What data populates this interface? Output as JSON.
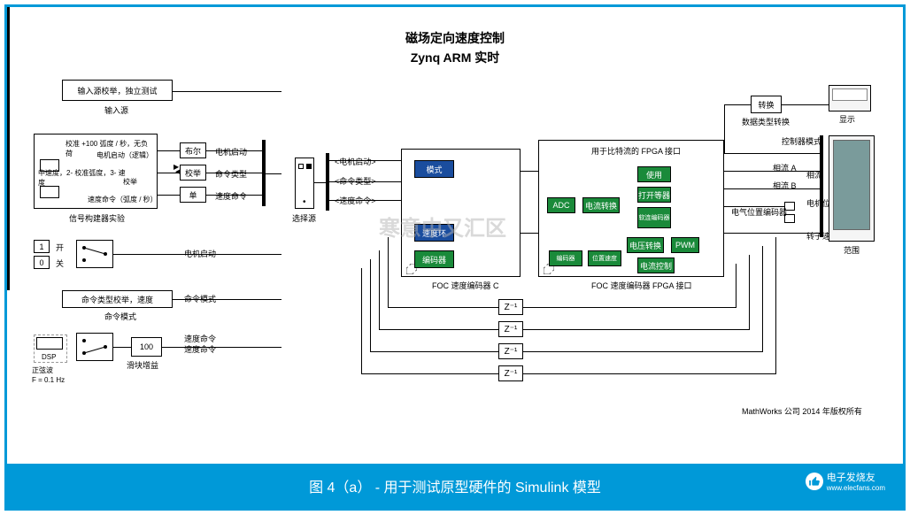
{
  "title": {
    "line1": "磁场定向速度控制",
    "line2": "Zynq ARM 实时"
  },
  "input_source": {
    "header": "输入源校举，独立测试",
    "label": "输入源"
  },
  "signal_builder": {
    "text1": "校准 +100 弧度 / 秒，无负荷",
    "text2": "电机启动（逻辑）",
    "text3": "中速度，2- 校准弧度，3- 速度",
    "text4": "校举",
    "text5": "速度命令（弧度 / 秒）",
    "label": "信号构建器实验"
  },
  "converter_blocks": {
    "bool": "布尔",
    "enum": "校举",
    "single": "单"
  },
  "port_labels": {
    "motor_start": "电机启动",
    "cmd_type": "命令类型",
    "speed_cmd": "速度命令"
  },
  "switches": {
    "on": "开",
    "off": "关",
    "motor_start": "电机启动",
    "const_1": "1",
    "const_0": "0"
  },
  "cmd_mode": {
    "header": "命令类型校举，速度",
    "label": "命令模式",
    "port": "命令模式"
  },
  "speed_gen": {
    "sine_label": "正弦波",
    "freq": "F = 0.1 Hz",
    "dsp": "DSP",
    "gain": "100",
    "gain_label": "滑块增益",
    "speed_cmd": "速度命令",
    "speed_cmd2": "速度命令"
  },
  "selection": "选择源",
  "demux_labels": {
    "motor_start": "<电机启动>",
    "cmd_type": "<命令类型>",
    "speed_cmd": "<速度命令>"
  },
  "foc_c": {
    "mode": "模式",
    "speed_loop": "速度环",
    "encoder": "编码器",
    "label": "FOC 速度编码器 C"
  },
  "fpga": {
    "title": "用于比特流的 FPGA 接口",
    "adc": "ADC",
    "current_trans": "电流转换",
    "enable": "使用",
    "open_close": "打开等器",
    "soft_encoder": "软连编码器",
    "volt_trans": "电压转换",
    "pwm": "PWM",
    "pos_speed": "位置速度",
    "current_ctrl": "电流控制",
    "label": "FOC 速度编码器 FPGA 接口"
  },
  "delays": {
    "z1": "Z⁻¹",
    "z2": "Z⁻¹",
    "z3": "Z⁻¹",
    "z4": "Z⁻¹"
  },
  "conversion": {
    "convert": "转换",
    "label": "数据类型转换"
  },
  "outputs": {
    "display": "显示",
    "scope": "范围",
    "ctrl_mode": "控制器模式",
    "phase_a": "相流 A",
    "phase": "相流",
    "phase_b": "相流 B",
    "motor_pos": "电机位置",
    "elec_pos": "电气位置编码器",
    "rotor_speed": "转子速度"
  },
  "copyright": "MathWorks 公司 2014 年版权所有",
  "footer": {
    "caption": "图 4（a） - 用于测试原型硬件的 Simulink 模型",
    "logo_text": "电子发烧友",
    "logo_url": "www.elecfans.com"
  },
  "watermark": "寒意中又汇区"
}
